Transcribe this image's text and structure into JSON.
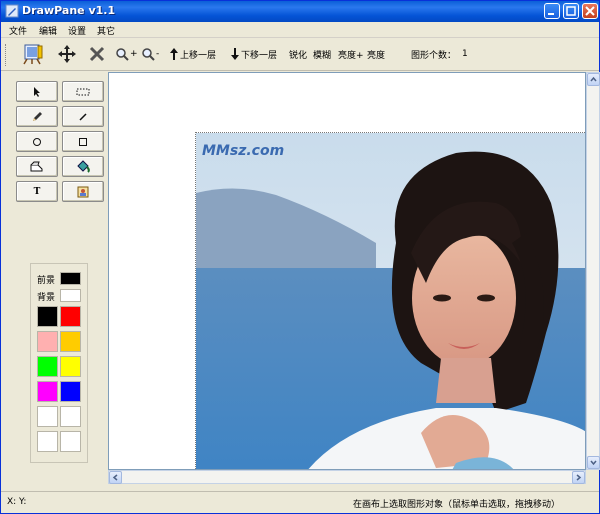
{
  "window": {
    "title": "DrawPane v1.1"
  },
  "menu": {
    "items": [
      "文件",
      "编辑",
      "设置",
      "其它"
    ]
  },
  "toolbar": {
    "zoom_in_label": "+",
    "zoom_out_label": "-",
    "move_up_label": "上移一层",
    "move_down_label": "下移一层",
    "sharpen_label": "锐化",
    "blur_label": "模糊",
    "brighten_label": "亮度+",
    "brightness_label": "亮度",
    "shape_count_label": "图形个数：",
    "shape_count_value": "1"
  },
  "tools": {
    "items": [
      "select",
      "rect-select",
      "pencil",
      "line",
      "ellipse",
      "rectangle",
      "eraser",
      "fill-bucket",
      "text",
      "image"
    ],
    "text_glyph": "T"
  },
  "palette": {
    "foreground_label": "前景",
    "background_label": "背景",
    "foreground_color": "#000000",
    "background_color": "#ffffff",
    "swatches": [
      "#000000",
      "#ff0000",
      "#ffb0b0",
      "#ffcc00",
      "#00ff00",
      "#ffff00",
      "#ff00ff",
      "#0000ff",
      "#ffffff",
      "#ffffff",
      "#ffffff",
      "#ffffff"
    ]
  },
  "canvas": {
    "watermark": "MMsz.com"
  },
  "status": {
    "coords_label": "X:   Y:",
    "hint": "在画布上选取图形对象（鼠标单击选取，拖拽移动）"
  }
}
